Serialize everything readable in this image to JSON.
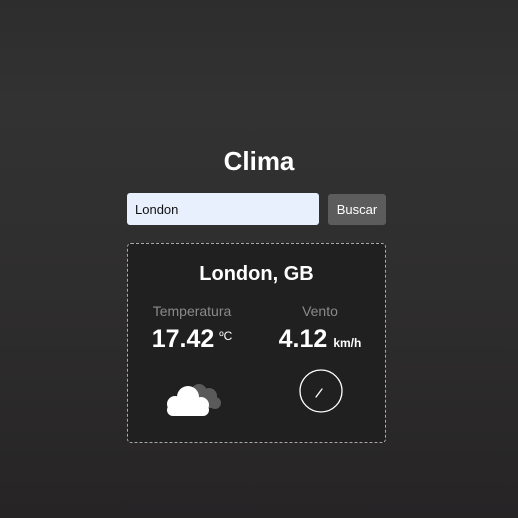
{
  "app": {
    "title": "Clima"
  },
  "search": {
    "value": "London",
    "button_label": "Buscar"
  },
  "weather": {
    "city": "London, GB",
    "temperature": {
      "label": "Temperatura",
      "value": "17.42",
      "unit": "ºC"
    },
    "wind": {
      "label": "Vento",
      "value": "4.12",
      "unit": "km/h"
    },
    "condition_icon": "cloud-icon",
    "wind_icon": "compass-icon"
  },
  "colors": {
    "input_bg": "#e8f0fe",
    "button_bg": "#5c5c5c",
    "card_bg": "#212020",
    "card_border": "#a9a9a9",
    "label_text": "#8a8a8a"
  }
}
